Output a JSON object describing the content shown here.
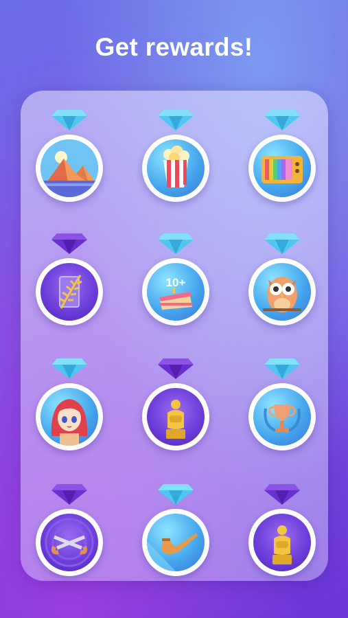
{
  "header": {
    "title": "Get rewards!"
  },
  "rewards": [
    {
      "icon": "mountains-icon",
      "gem": "blue",
      "face": "blue"
    },
    {
      "icon": "popcorn-icon",
      "gem": "blue",
      "face": "blue"
    },
    {
      "icon": "retro-tv-icon",
      "gem": "blue",
      "face": "blue"
    },
    {
      "icon": "palm-branch-icon",
      "gem": "purple",
      "face": "purple"
    },
    {
      "icon": "birthday-cake-icon",
      "gem": "blue",
      "face": "blue",
      "caption": "10+"
    },
    {
      "icon": "owl-icon",
      "gem": "blue",
      "face": "blue"
    },
    {
      "icon": "anime-girl-icon",
      "gem": "blue",
      "face": "blue"
    },
    {
      "icon": "oscar-statue-icon",
      "gem": "purple",
      "face": "purple"
    },
    {
      "icon": "trophy-cup-icon",
      "gem": "blue",
      "face": "blue"
    },
    {
      "icon": "crossed-pistols-icon",
      "gem": "purple",
      "face": "purple"
    },
    {
      "icon": "smoking-pipe-icon",
      "gem": "blue",
      "face": "blue"
    },
    {
      "icon": "oscar-statue-icon",
      "gem": "purple",
      "face": "purple"
    }
  ],
  "colors": {
    "gem_blue": "#4fc7ee",
    "gem_purple": "#6a2fcf",
    "ring": "#ffffff"
  }
}
